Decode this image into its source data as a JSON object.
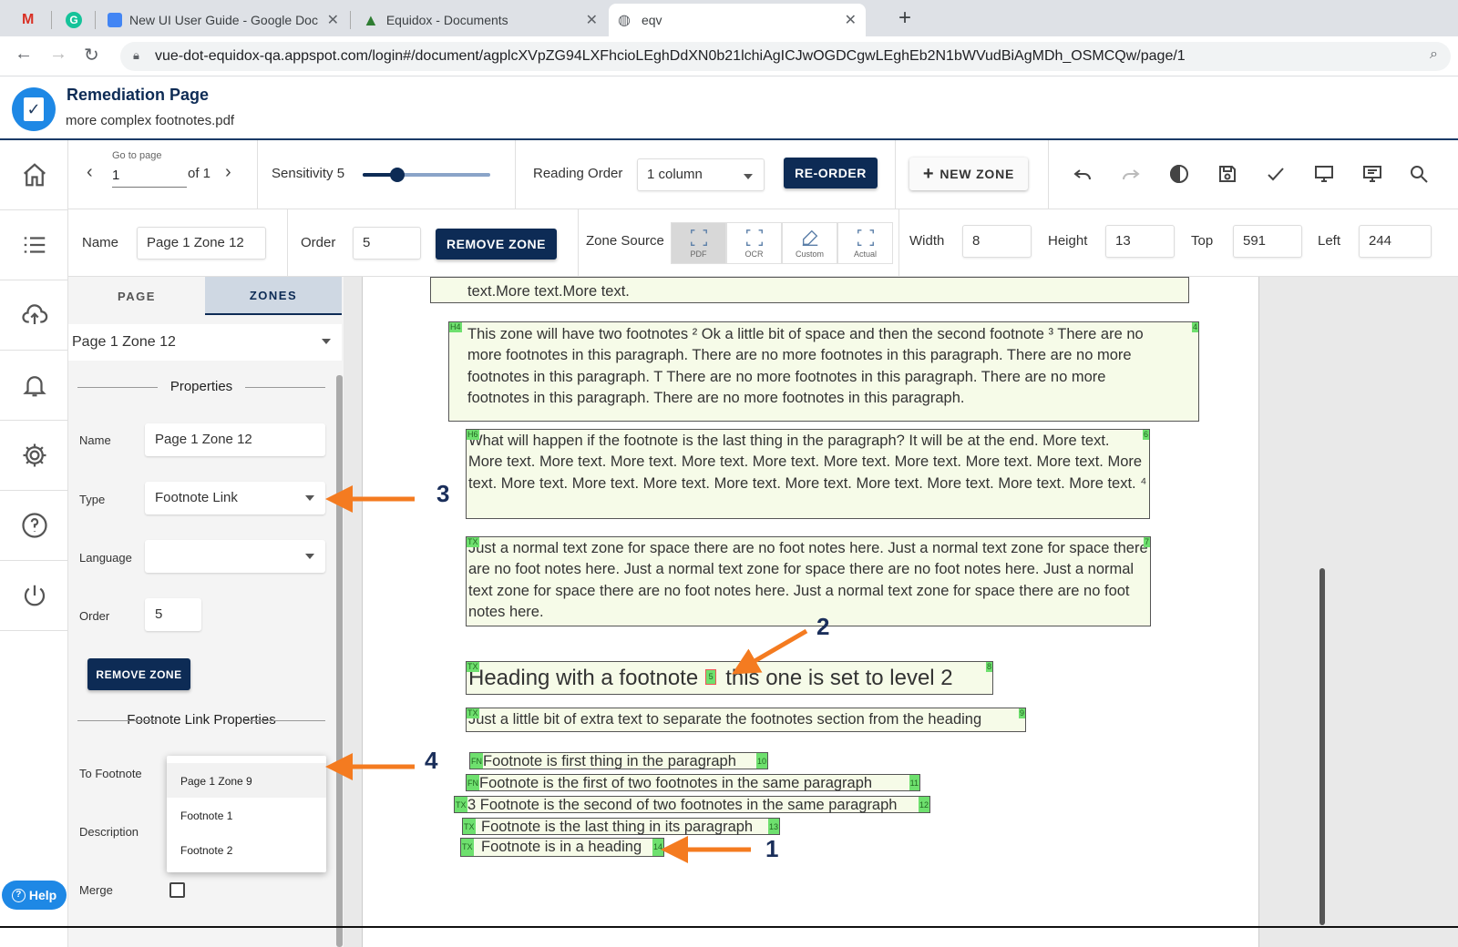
{
  "browser": {
    "tabs": [
      {
        "title": "",
        "icon": "gmail-icon"
      },
      {
        "title": "",
        "icon": "grammarly-icon"
      },
      {
        "title": "New UI User Guide - Google Doc",
        "icon": "docs-icon"
      },
      {
        "title": "Equidox - Documents",
        "icon": "equidox-icon"
      },
      {
        "title": "eqv",
        "icon": "globe-icon"
      }
    ],
    "url": "vue-dot-equidox-qa.appspot.com/login#/document/agplcXVpZG94LXFhcioLEghDdXN0b21lchiAgICJwOGDCgwLEghEb2N1bWVudBiAgMDh_OSMCQw/page/1"
  },
  "header": {
    "title": "Remediation Page",
    "filename": "more complex footnotes.pdf"
  },
  "toolbar": {
    "goto_label": "Go to page",
    "page_value": "1",
    "page_of": "of 1",
    "sensitivity_label": "Sensitivity 5",
    "sensitivity_value": 5,
    "reading_order_label": "Reading Order",
    "reading_order_value": "1 column",
    "reorder_label": "RE-ORDER",
    "new_zone_label": "NEW ZONE"
  },
  "zone_bar": {
    "name_label": "Name",
    "name_value": "Page 1 Zone 12",
    "order_label": "Order",
    "order_value": "5",
    "remove_label": "REMOVE ZONE",
    "source_label": "Zone Source",
    "sources": [
      "PDF",
      "OCR",
      "Custom",
      "Actual"
    ],
    "width_label": "Width",
    "width_value": "8",
    "height_label": "Height",
    "height_value": "13",
    "top_label": "Top",
    "top_value": "591",
    "left_label": "Left",
    "left_value": "244"
  },
  "panel": {
    "tabs": [
      "PAGE",
      "ZONES"
    ],
    "zone_select": "Page 1 Zone 12",
    "properties_title": "Properties",
    "name_label": "Name",
    "name_value": "Page 1 Zone 12",
    "type_label": "Type",
    "type_value": "Footnote Link",
    "language_label": "Language",
    "language_value": "",
    "order_label": "Order",
    "order_value": "5",
    "remove_label": "REMOVE ZONE",
    "fl_title": "Footnote Link Properties",
    "to_footnote_label": "To Footnote",
    "description_label": "Description",
    "merge_label": "Merge",
    "dropdown_options": [
      "Page 1 Zone 9",
      "Footnote 1",
      "Footnote 2"
    ]
  },
  "help_label": "Help",
  "document": {
    "zone_top_text": "text.More text.More text.",
    "zone_a_text": "This zone will have two footnotes ² Ok a little bit of space and then the second footnote ³ There are no more footnotes in this paragraph. There are no more footnotes in this paragraph. There are no more footnotes in this paragraph. T There are no more footnotes in this paragraph. There are no more footnotes in this paragraph. There are no more footnotes in this paragraph.",
    "zone_a_tag_l": "H4",
    "zone_a_tag_r": "4",
    "zone_b_text": "What will happen if the footnote is the last thing in the paragraph? It will be at the end. More text. More text. More text. More text. More text. More text. More text. More text. More text. More text. More text. More text. More text. More text. More text. More text. More text. More text. More text. More text. ⁴",
    "zone_b_tag_l": "H6",
    "zone_b_tag_r": "6",
    "zone_c_text": "Just a normal text zone for space there are no foot notes here. Just a normal text zone for space there are no foot notes here. Just a normal text zone for space there are no foot notes here. Just a normal text zone for space there are no foot notes here. Just a normal text zone for space there are no foot notes here.",
    "zone_c_tag_l": "TX",
    "zone_c_tag_r": "7",
    "heading_part1": "Heading with a footnote",
    "heading_part2": "this one is set to level 2",
    "heading_fn_tag": "5",
    "heading_tag_l": "TX",
    "heading_tag_r": "8",
    "extra_text": "Just a little bit of extra text to separate the footnotes section from the heading",
    "extra_tag_l": "TX",
    "extra_tag_r": "9",
    "footnotes": [
      {
        "text": "Footnote is first thing in the paragraph",
        "tag_l": "FN",
        "tag_r": "10"
      },
      {
        "text": "Footnote is the first of two footnotes in the same paragraph",
        "tag_l": "FN",
        "tag_r": "11"
      },
      {
        "text": "3 Footnote is the second of two footnotes in the same paragraph",
        "tag_l": "TX",
        "tag_r": "12"
      },
      {
        "text": "Footnote is the last thing in its paragraph",
        "tag_l": "TX",
        "tag_r": "13"
      },
      {
        "text": "Footnote is in a heading",
        "tag_l": "TX",
        "tag_r": "14"
      }
    ]
  },
  "annotations": [
    "1",
    "2",
    "3",
    "4"
  ],
  "colors": {
    "brand_dark": "#0d2b55",
    "accent": "#1e88e5",
    "arrow": "#f47b20",
    "zone_tag": "#6ee06e"
  }
}
